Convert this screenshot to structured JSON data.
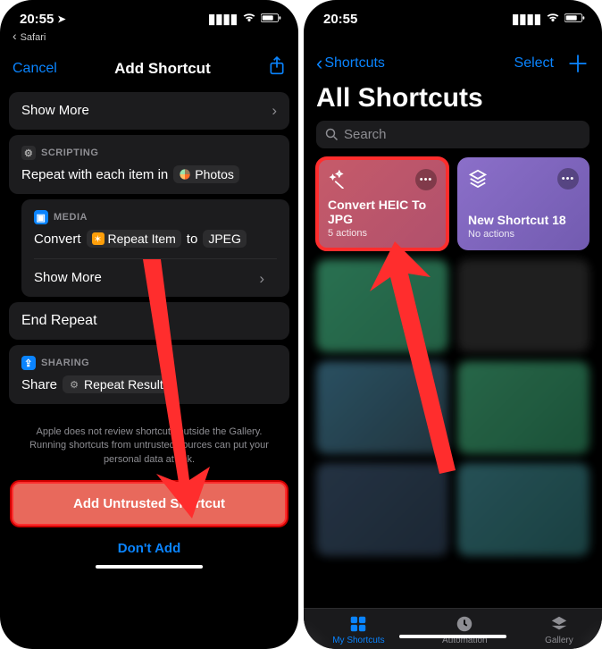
{
  "left": {
    "status": {
      "time": "20:55",
      "back_app": "Safari"
    },
    "nav": {
      "cancel": "Cancel",
      "title": "Add Shortcut"
    },
    "show_more": "Show More",
    "scripting_label": "SCRIPTING",
    "repeat_line_prefix": "Repeat with each item in",
    "repeat_token": "Photos",
    "media_label": "MEDIA",
    "convert_prefix": "Convert",
    "repeat_item_token": "Repeat Item",
    "convert_mid": "to",
    "jpeg_token": "JPEG",
    "show_more2": "Show More",
    "end_repeat": "End Repeat",
    "sharing_label": "SHARING",
    "share_prefix": "Share",
    "repeat_results_token": "Repeat Results",
    "helper": "Apple does not review shortcuts outside the Gallery. Running shortcuts from untrusted sources can put your personal data at risk.",
    "danger": "Add Untrusted Shortcut",
    "dont_add": "Don't Add"
  },
  "right": {
    "status": {
      "time": "20:55"
    },
    "back": "Shortcuts",
    "select": "Select",
    "title": "All Shortcuts",
    "search_placeholder": "Search",
    "tiles": [
      {
        "name": "Convert HEIC To JPG",
        "sub": "5 actions"
      },
      {
        "name": "New Shortcut 18",
        "sub": "No actions"
      }
    ],
    "tabs": {
      "my": "My Shortcuts",
      "auto": "Automation",
      "gallery": "Gallery"
    }
  }
}
